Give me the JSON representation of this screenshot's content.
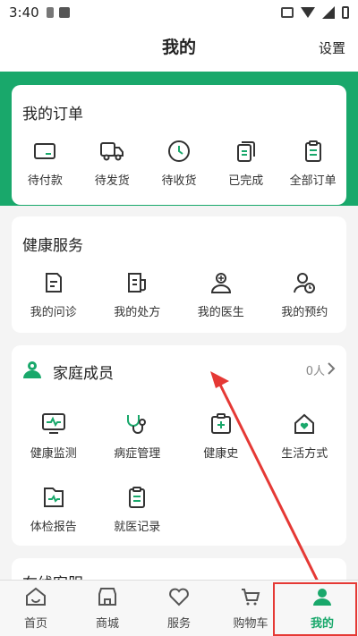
{
  "status_bar": {
    "time": "3:40"
  },
  "header": {
    "title": "我的",
    "settings_label": "设置"
  },
  "orders": {
    "title": "我的订单",
    "items": [
      {
        "label": "待付款",
        "icon": "wallet-icon"
      },
      {
        "label": "待发货",
        "icon": "truck-icon"
      },
      {
        "label": "待收货",
        "icon": "clock-icon"
      },
      {
        "label": "已完成",
        "icon": "copy-icon"
      },
      {
        "label": "全部订单",
        "icon": "clipboard-icon"
      }
    ]
  },
  "health_services": {
    "title": "健康服务",
    "items": [
      {
        "label": "我的问诊",
        "icon": "consult-icon"
      },
      {
        "label": "我的处方",
        "icon": "prescription-icon"
      },
      {
        "label": "我的医生",
        "icon": "doctor-icon"
      },
      {
        "label": "我的预约",
        "icon": "appointment-icon"
      }
    ]
  },
  "family": {
    "title": "家庭成员",
    "count": "0人",
    "items": [
      {
        "label": "健康监测",
        "icon": "monitor-icon"
      },
      {
        "label": "病症管理",
        "icon": "stethoscope-icon"
      },
      {
        "label": "健康史",
        "icon": "medical-kit-icon"
      },
      {
        "label": "生活方式",
        "icon": "home-heart-icon"
      },
      {
        "label": "体检报告",
        "icon": "report-icon"
      },
      {
        "label": "就医记录",
        "icon": "record-icon"
      }
    ]
  },
  "online_service": {
    "title": "在线客服"
  },
  "bottom_nav": [
    {
      "label": "首页",
      "icon": "home-icon"
    },
    {
      "label": "商城",
      "icon": "shop-icon"
    },
    {
      "label": "服务",
      "icon": "heart-icon"
    },
    {
      "label": "购物车",
      "icon": "cart-icon"
    },
    {
      "label": "我的",
      "icon": "user-icon",
      "active": true
    }
  ],
  "colors": {
    "accent": "#19a86b",
    "annotation": "#e53935"
  }
}
